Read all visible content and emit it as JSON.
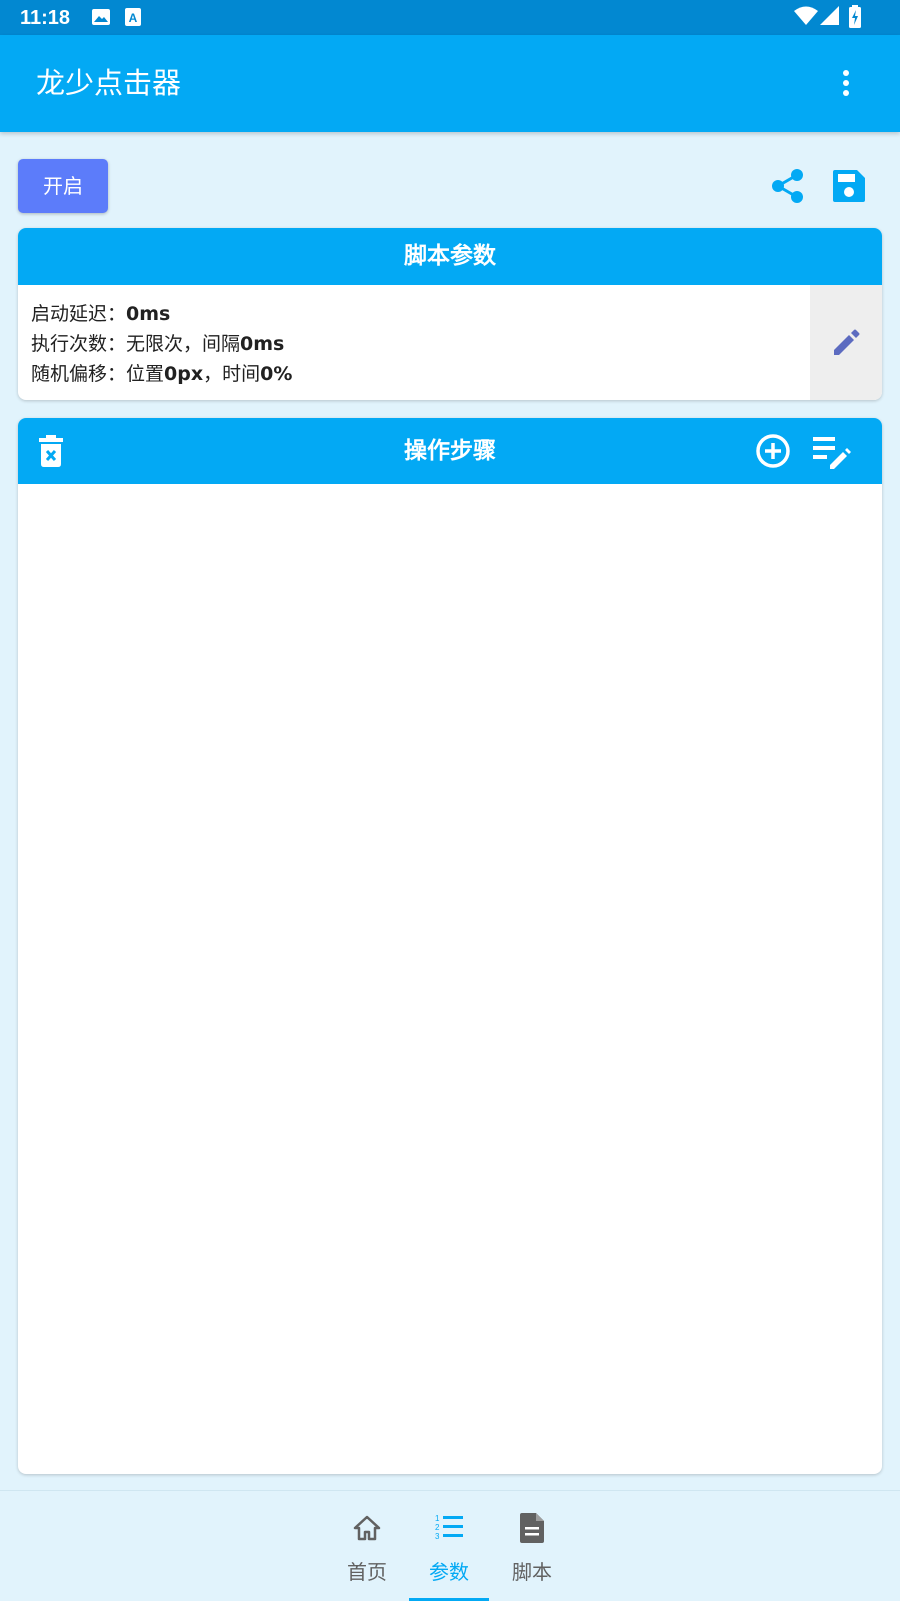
{
  "status_bar": {
    "time": "11:18",
    "icons": [
      "image-icon",
      "text-a-icon",
      "wifi-icon",
      "cell-signal-icon",
      "battery-charging-icon"
    ]
  },
  "app_bar": {
    "title": "龙少点击器",
    "menu_icon": "more-vert-icon"
  },
  "toolbar": {
    "start_label": "开启",
    "share_icon": "share-icon",
    "save_icon": "save-icon"
  },
  "params": {
    "title": "脚本参数",
    "start_delay_label": "启动延迟：",
    "start_delay_value": "0ms",
    "exec_count_label": "执行次数：",
    "exec_count_value": "无限次，间隔",
    "exec_interval_value": "0ms",
    "offset_label": "随机偏移：",
    "offset_position_text": "位置",
    "offset_position_value": "0px",
    "offset_time_text": "，时间",
    "offset_time_value": "0%",
    "edit_icon": "pencil-icon"
  },
  "steps": {
    "title": "操作步骤",
    "delete_icon": "delete-icon",
    "add_icon": "add-circle-icon",
    "edit_list_icon": "edit-list-icon",
    "items": []
  },
  "bottom_nav": {
    "items": [
      {
        "label": "首页",
        "icon": "home-icon",
        "active": false
      },
      {
        "label": "参数",
        "icon": "numbered-list-icon",
        "active": true
      },
      {
        "label": "脚本",
        "icon": "document-icon",
        "active": false
      }
    ]
  },
  "colors": {
    "status_bar": "#0288d1",
    "primary": "#03a9f4",
    "start_button": "#5c7cfa",
    "background": "#e1f3fc"
  }
}
